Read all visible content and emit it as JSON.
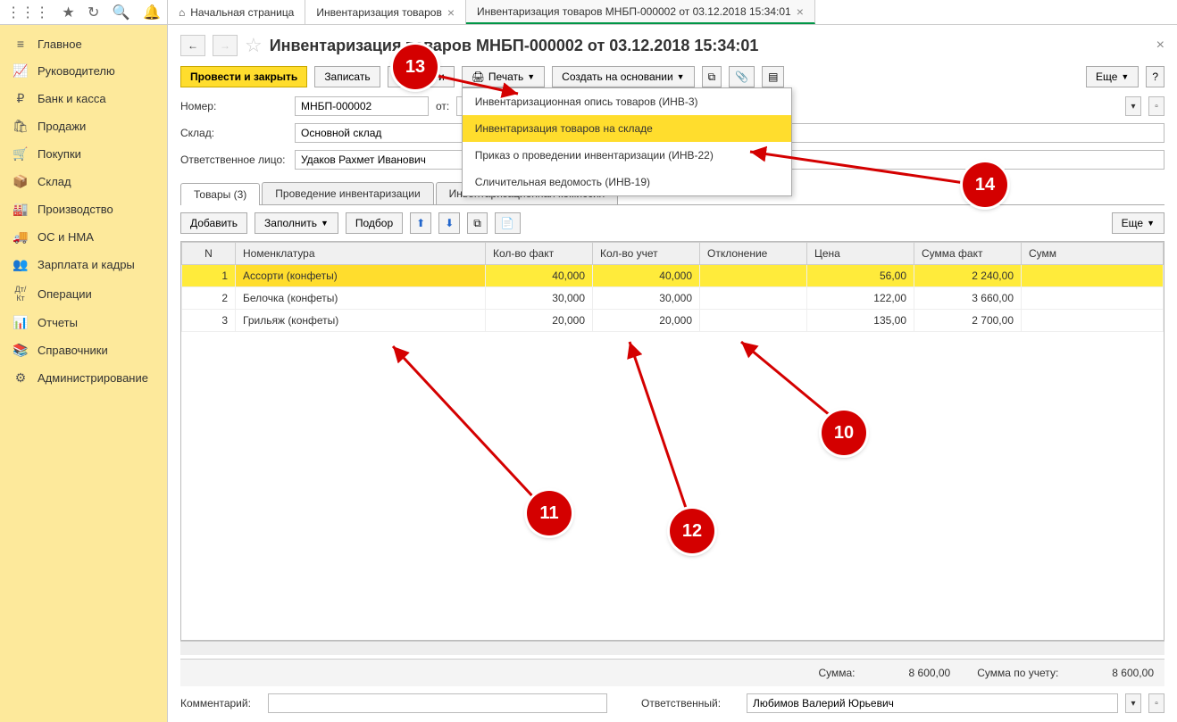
{
  "topTabs": {
    "home": "Начальная страница",
    "tab1": "Инвентаризация товаров",
    "tab2": "Инвентаризация товаров МНБП-000002 от 03.12.2018 15:34:01"
  },
  "sidebar": {
    "items": [
      {
        "icon": "≡",
        "label": "Главное"
      },
      {
        "icon": "📈",
        "label": "Руководителю"
      },
      {
        "icon": "₽",
        "label": "Банк и касса"
      },
      {
        "icon": "🛍",
        "label": "Продажи"
      },
      {
        "icon": "🛒",
        "label": "Покупки"
      },
      {
        "icon": "📦",
        "label": "Склад"
      },
      {
        "icon": "🏭",
        "label": "Производство"
      },
      {
        "icon": "🚚",
        "label": "ОС и НМА"
      },
      {
        "icon": "👥",
        "label": "Зарплата и кадры"
      },
      {
        "icon": "Дт/Кт",
        "label": "Операции"
      },
      {
        "icon": "📊",
        "label": "Отчеты"
      },
      {
        "icon": "📚",
        "label": "Справочники"
      },
      {
        "icon": "⚙",
        "label": "Администрирование"
      }
    ]
  },
  "header": {
    "title": "Инвентаризация товаров МНБП-000002 от 03.12.2018 15:34:01"
  },
  "actions": {
    "main": "Провести и закрыть",
    "save": "Записать",
    "post": "Провести",
    "print": "Печать",
    "createBased": "Создать на основании",
    "more": "Еще"
  },
  "printMenu": {
    "item1": "Инвентаризационная опись товаров (ИНВ-3)",
    "item2": "Инвентаризация товаров на складе",
    "item3": "Приказ о проведении инвентаризации (ИНВ-22)",
    "item4": "Сличительная ведомость (ИНВ-19)"
  },
  "form": {
    "numberLabel": "Номер:",
    "numberValue": "МНБП-000002",
    "dateLabel": "от:",
    "dateValue": "03.12.2018 15:34:01",
    "warehouseLabel": "Склад:",
    "warehouseValue": "Основной склад",
    "responsibleLabel": "Ответственное лицо:",
    "responsibleValue": "Удаков Рахмет Иванович"
  },
  "subTabs": {
    "tab1": "Товары (3)",
    "tab2": "Проведение инвентаризации",
    "tab3": "Инвентаризационная комиссия"
  },
  "tableToolbar": {
    "add": "Добавить",
    "fill": "Заполнить",
    "select": "Подбор",
    "more": "Еще"
  },
  "columns": {
    "n": "N",
    "nom": "Номенклатура",
    "qtyFact": "Кол-во факт",
    "qtyAcc": "Кол-во учет",
    "dev": "Отклонение",
    "price": "Цена",
    "sumFact": "Сумма факт",
    "sumAcc": "Сумм"
  },
  "rows": [
    {
      "n": "1",
      "nom": "Ассорти (конфеты)",
      "qf": "40,000",
      "qa": "40,000",
      "dev": "",
      "price": "56,00",
      "sf": "2 240,00"
    },
    {
      "n": "2",
      "nom": "Белочка (конфеты)",
      "qf": "30,000",
      "qa": "30,000",
      "dev": "",
      "price": "122,00",
      "sf": "3 660,00"
    },
    {
      "n": "3",
      "nom": "Грильяж (конфеты)",
      "qf": "20,000",
      "qa": "20,000",
      "dev": "",
      "price": "135,00",
      "sf": "2 700,00"
    }
  ],
  "footer": {
    "sumLabel": "Сумма:",
    "sumValue": "8 600,00",
    "sumAccLabel": "Сумма по учету:",
    "sumAccValue": "8 600,00",
    "commentLabel": "Комментарий:",
    "commentValue": "",
    "respLabel": "Ответственный:",
    "respValue": "Любимов Валерий Юрьевич"
  },
  "annotations": {
    "a10": "10",
    "a11": "11",
    "a12": "12",
    "a13": "13",
    "a14": "14"
  }
}
